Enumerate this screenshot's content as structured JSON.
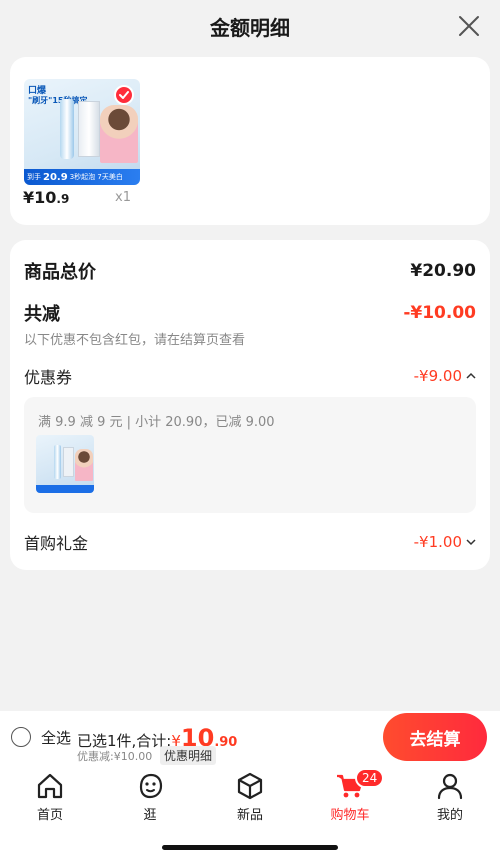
{
  "header": {
    "title": "金额明细"
  },
  "product": {
    "price_symbol": "¥",
    "price_int": "10",
    "price_dec": ".9",
    "quantity": "x1",
    "image_brand": "口爆",
    "image_tag": "\"刷牙\"15秒搞定",
    "image_strip_prefix": "到手",
    "image_strip_price": "20.9",
    "image_strip_text": "3秒起泡 7天美白",
    "selected": true
  },
  "detail": {
    "total_label": "商品总价",
    "total_value": "¥20.90",
    "reduce_label": "共减",
    "reduce_value": "-¥10.00",
    "reduce_note": "以下优惠不包含红包，请在结算页查看",
    "coupon_label": "优惠券",
    "coupon_value": "-¥9.00",
    "coupon_chevron": "up",
    "coupon_desc": "满 9.9 减 9 元 | 小计 20.90，已减 9.00",
    "first_label": "首购礼金",
    "first_value": "-¥1.00",
    "first_chevron": "down"
  },
  "bottom_bar": {
    "select_all_label": "全选",
    "summary_prefix": "已选1件,合计:",
    "amount_symbol": "¥",
    "amount_int": "10",
    "amount_dec": ".90",
    "discount_note": "优惠减:¥10.00",
    "detail_link": "优惠明细",
    "checkout_label": "去结算"
  },
  "tabbar": {
    "tabs": [
      {
        "label": "首页",
        "icon": "home-icon"
      },
      {
        "label": "逛",
        "icon": "browse-face-icon"
      },
      {
        "label": "新品",
        "icon": "cube-icon"
      },
      {
        "label": "购物车",
        "icon": "cart-icon",
        "badge": "24",
        "active": true
      },
      {
        "label": "我的",
        "icon": "person-icon"
      }
    ]
  },
  "colors": {
    "accent": "#ff3b22",
    "background": "#f2f2f2",
    "card": "#ffffff"
  }
}
